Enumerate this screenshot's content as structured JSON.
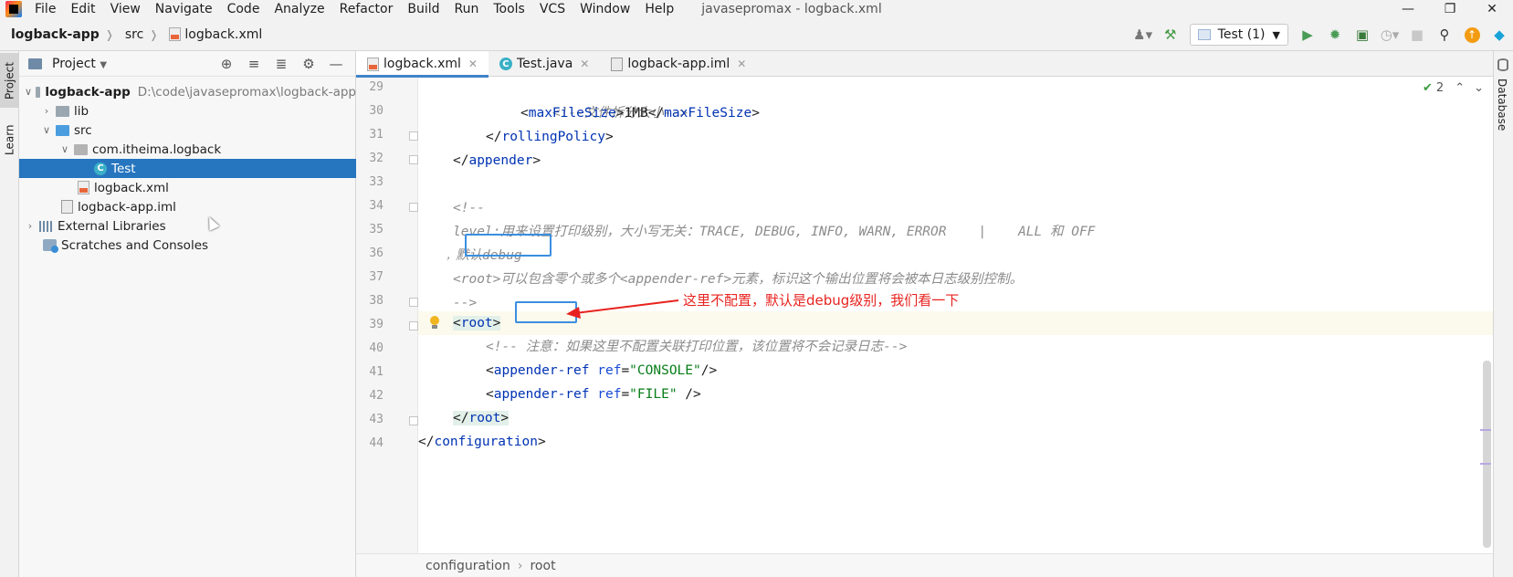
{
  "menubar": {
    "items": [
      "File",
      "Edit",
      "View",
      "Navigate",
      "Code",
      "Analyze",
      "Refactor",
      "Build",
      "Run",
      "Tools",
      "VCS",
      "Window",
      "Help"
    ],
    "window_title": "javasepromax - logback.xml"
  },
  "navbar": {
    "crumbs": [
      "logback-app",
      "src",
      "logback.xml"
    ],
    "run_config": "Test (1)"
  },
  "stripes": {
    "project": "Project",
    "learn": "Learn",
    "database": "Database"
  },
  "project_panel": {
    "title": "Project",
    "tree": [
      {
        "label": "logback-app",
        "path": "D:\\code\\javasepromax\\logback-app"
      },
      {
        "label": "lib"
      },
      {
        "label": "src"
      },
      {
        "label": "com.itheima.logback"
      },
      {
        "label": "Test"
      },
      {
        "label": "logback.xml"
      },
      {
        "label": "logback-app.iml"
      },
      {
        "label": "External Libraries"
      },
      {
        "label": "Scratches and Consoles"
      }
    ]
  },
  "editor_tabs": [
    {
      "label": "logback.xml"
    },
    {
      "label": "Test.java"
    },
    {
      "label": "logback-app.iml"
    }
  ],
  "inspection": {
    "count": "2"
  },
  "editor": {
    "line_numbers": [
      "29",
      "30",
      "31",
      "32",
      "33",
      "34",
      "35",
      "36",
      "37",
      "38",
      "39",
      "40",
      "41",
      "42",
      "43",
      "44"
    ],
    "lines": {
      "l29": "<!--文件拆分大小-->",
      "l30_tag_open": "maxFileSize",
      "l30_value": "1MB",
      "l30_tag_close": "maxFileSize",
      "l31_tag": "rollingPolicy",
      "l32_tag": "appender",
      "l34": "<!--",
      "l35": "level:用来设置打印级别，大小写无关：TRACE, DEBUG, INFO, WARN, ERROR    |    ALL 和 OFF",
      "l36_prefix": "，",
      "l36": "默认debug",
      "l37": "<root>可以包含零个或多个<appender-ref>元素，标识这个输出位置将会被本日志级别控制。",
      "l38": "-->",
      "l39_tag": "root",
      "l40": "<!-- 注意：如果这里不配置关联打印位置，该位置将不会记录日志-->",
      "l41_tag": "appender-ref",
      "l41_attr": "ref",
      "l41_val": "\"CONSOLE\"",
      "l42_tag": "appender-ref",
      "l42_attr": "ref",
      "l42_val": "\"FILE\"",
      "l43_tag": "root",
      "l44_tag": "configuration"
    },
    "annotation": "这里不配置，默认是debug级别，我们看一下"
  },
  "editor_breadcrumbs": [
    "configuration",
    "root"
  ],
  "colors": {
    "selection": "#2675bf",
    "annotation": "#e8231f",
    "highlight_box": "#3b8fe0",
    "xml_tag": "#0033b3",
    "xml_string": "#067d17",
    "comment": "#8c8c8c"
  }
}
